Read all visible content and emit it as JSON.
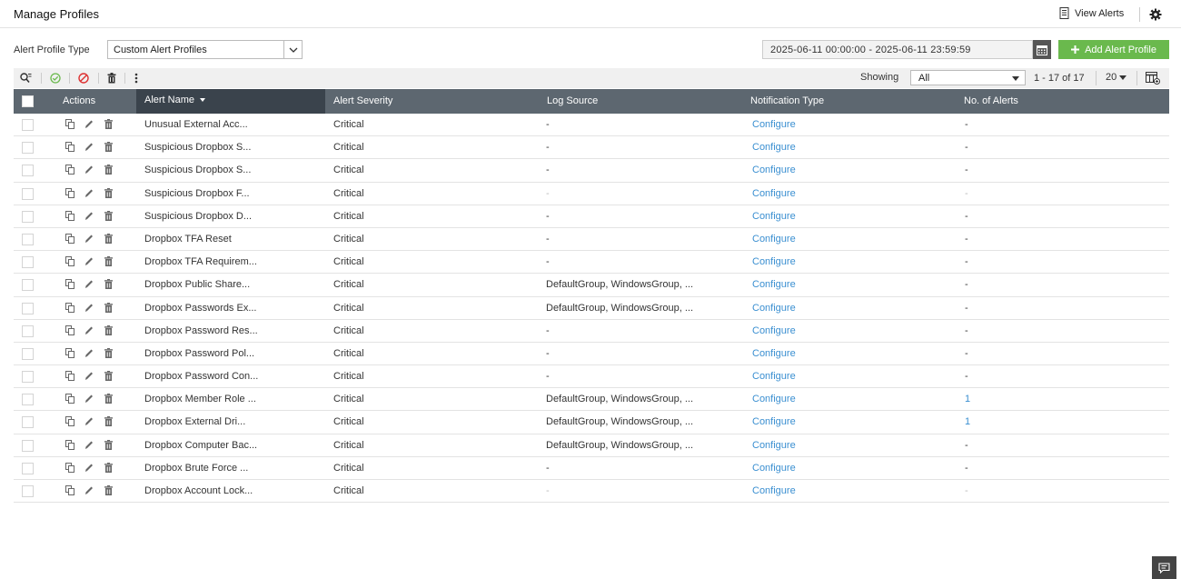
{
  "header": {
    "title": "Manage Profiles",
    "view_alerts_label": "View Alerts"
  },
  "filters": {
    "profile_type_label": "Alert Profile Type",
    "profile_type_value": "Custom Alert Profiles",
    "date_range": "2025-06-11 00:00:00 - 2025-06-11 23:59:59",
    "add_button_label": "Add Alert Profile"
  },
  "toolbar": {
    "showing_label": "Showing",
    "showing_value": "All",
    "pagination": "1 - 17 of 17",
    "page_size": "20"
  },
  "columns": {
    "actions": "Actions",
    "alert_name": "Alert Name",
    "severity": "Alert Severity",
    "log_source": "Log Source",
    "notification": "Notification Type",
    "count": "No. of Alerts"
  },
  "rows": [
    {
      "name": "Unusual External Acc...",
      "severity": "Critical",
      "log_source": "-",
      "notification": "Configure",
      "count": "-"
    },
    {
      "name": "Suspicious Dropbox S...",
      "severity": "Critical",
      "log_source": "-",
      "notification": "Configure",
      "count": "-"
    },
    {
      "name": "Suspicious Dropbox S...",
      "severity": "Critical",
      "log_source": "-",
      "notification": "Configure",
      "count": "-"
    },
    {
      "name": "Suspicious Dropbox F...",
      "severity": "Critical",
      "log_source": "-",
      "notification": "Configure",
      "count": "-"
    },
    {
      "name": "Suspicious Dropbox D...",
      "severity": "Critical",
      "log_source": "-",
      "notification": "Configure",
      "count": "-"
    },
    {
      "name": "Dropbox TFA Reset",
      "severity": "Critical",
      "log_source": "-",
      "notification": "Configure",
      "count": "-"
    },
    {
      "name": "Dropbox TFA Requirem...",
      "severity": "Critical",
      "log_source": "-",
      "notification": "Configure",
      "count": "-"
    },
    {
      "name": "Dropbox Public Share...",
      "severity": "Critical",
      "log_source": "DefaultGroup, WindowsGroup, ...",
      "notification": "Configure",
      "count": "-"
    },
    {
      "name": "Dropbox Passwords Ex...",
      "severity": "Critical",
      "log_source": "DefaultGroup, WindowsGroup, ...",
      "notification": "Configure",
      "count": "-"
    },
    {
      "name": "Dropbox Password Res...",
      "severity": "Critical",
      "log_source": "-",
      "notification": "Configure",
      "count": "-"
    },
    {
      "name": "Dropbox Password Pol...",
      "severity": "Critical",
      "log_source": "-",
      "notification": "Configure",
      "count": "-"
    },
    {
      "name": "Dropbox Password Con...",
      "severity": "Critical",
      "log_source": "-",
      "notification": "Configure",
      "count": "-"
    },
    {
      "name": "Dropbox Member Role ...",
      "severity": "Critical",
      "log_source": "DefaultGroup, WindowsGroup, ...",
      "notification": "Configure",
      "count": "1"
    },
    {
      "name": "Dropbox External Dri...",
      "severity": "Critical",
      "log_source": "DefaultGroup, WindowsGroup, ...",
      "notification": "Configure",
      "count": "1"
    },
    {
      "name": "Dropbox Computer Bac...",
      "severity": "Critical",
      "log_source": "DefaultGroup, WindowsGroup, ...",
      "notification": "Configure",
      "count": "-"
    },
    {
      "name": "Dropbox Brute Force ...",
      "severity": "Critical",
      "log_source": "-",
      "notification": "Configure",
      "count": "-"
    },
    {
      "name": "Dropbox Account Lock...",
      "severity": "Critical",
      "log_source": "-",
      "notification": "Configure",
      "count": "-"
    }
  ],
  "colors": {
    "header_bg": "#5d6770",
    "sorted_header_bg": "#3a434c",
    "link": "#3a8fd1",
    "add_button": "#6ab94d"
  }
}
